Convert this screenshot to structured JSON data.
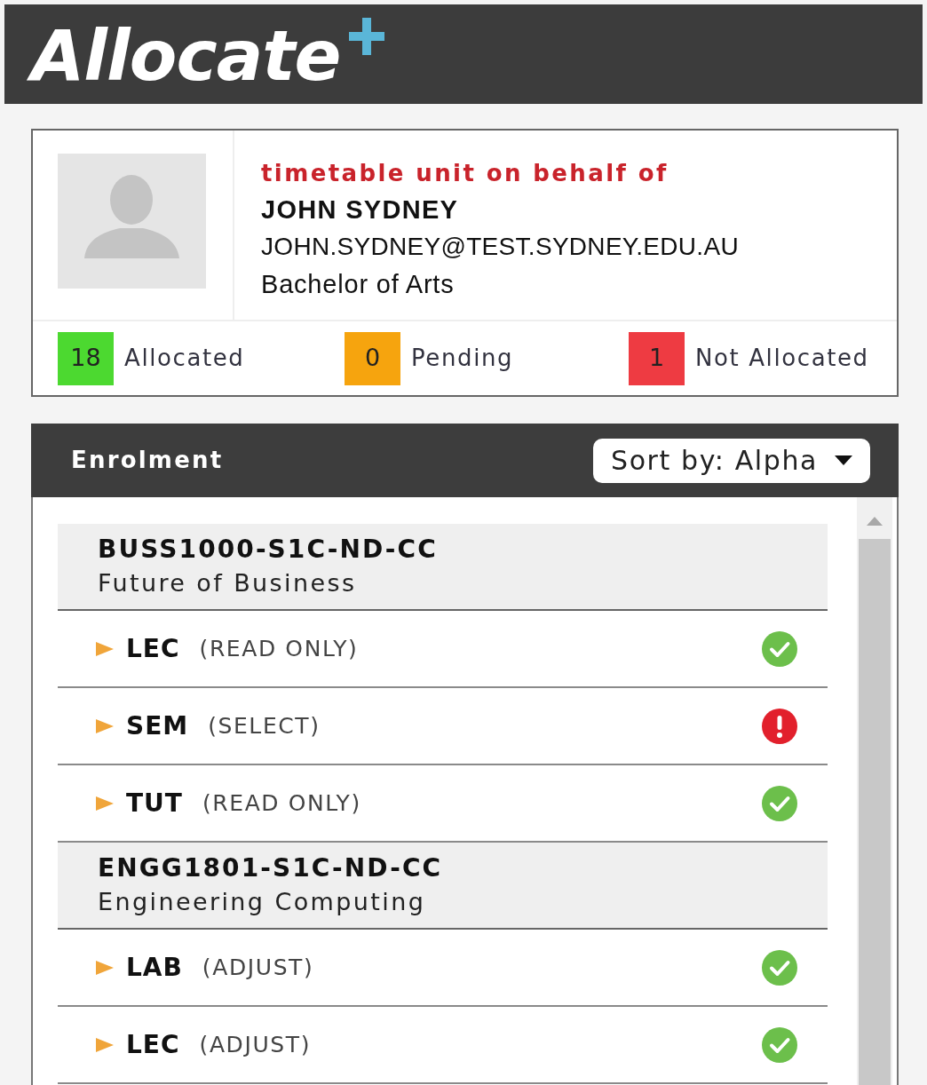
{
  "header": {
    "logo": "Allocate"
  },
  "profile": {
    "caption": "timetable unit on behalf of",
    "name": "JOHN SYDNEY",
    "email": "JOHN.SYDNEY@TEST.SYDNEY.EDU.AU",
    "program": "Bachelor of Arts"
  },
  "summary": [
    {
      "count": "18",
      "label": "Allocated",
      "color": "#4cd930"
    },
    {
      "count": "0",
      "label": "Pending",
      "color": "#f6a40e"
    },
    {
      "count": "1",
      "label": "Not Allocated",
      "color": "#ee3b42"
    }
  ],
  "enrolment": {
    "title": "Enrolment",
    "sort": {
      "label": "Sort by: Alpha"
    },
    "units": [
      {
        "code": "BUSS1000-S1C-ND-CC",
        "name": "Future of Business",
        "activities": [
          {
            "type": "LEC",
            "mode": "(READ ONLY)",
            "allocated": true
          },
          {
            "type": "SEM",
            "mode": "(SELECT)",
            "allocated": false
          },
          {
            "type": "TUT",
            "mode": "(READ ONLY)",
            "allocated": true
          }
        ]
      },
      {
        "code": "ENGG1801-S1C-ND-CC",
        "name": "Engineering Computing",
        "activities": [
          {
            "type": "LAB",
            "mode": "(ADJUST)",
            "allocated": true
          },
          {
            "type": "LEC",
            "mode": "(ADJUST)",
            "allocated": true
          }
        ]
      }
    ]
  }
}
